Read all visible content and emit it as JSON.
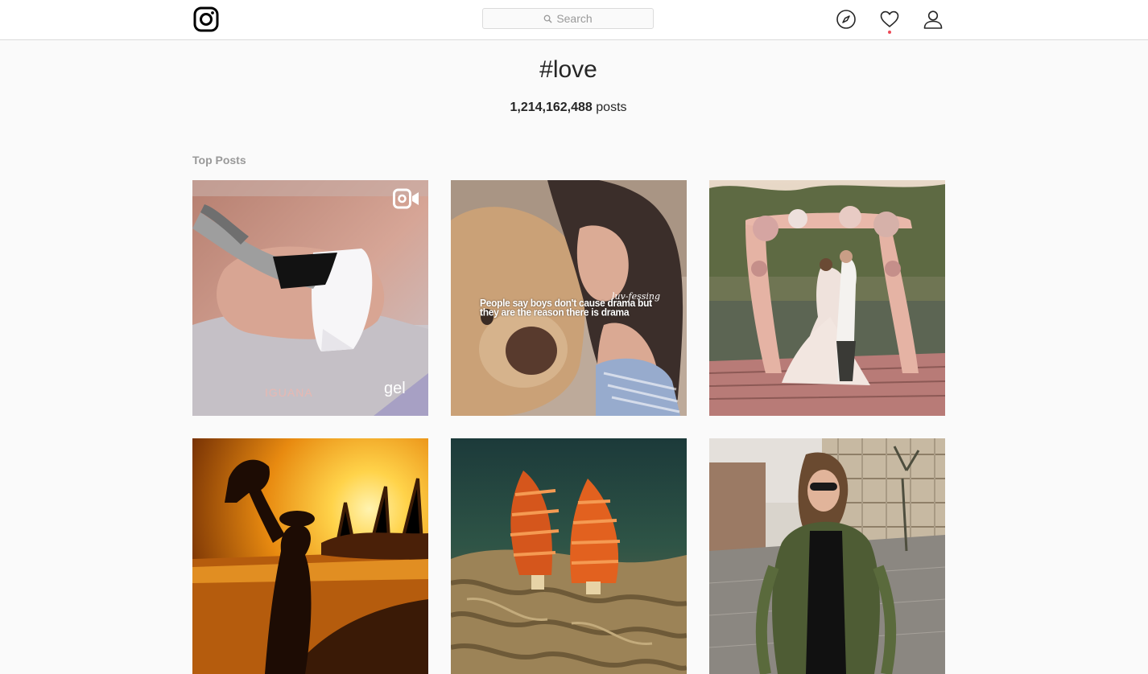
{
  "header": {
    "search_placeholder": "Search"
  },
  "hashtag": {
    "title": "#love",
    "post_count": "1,214,162,488",
    "post_count_suffix": "posts"
  },
  "section": {
    "top_posts_label": "Top Posts"
  },
  "posts": [
    {
      "subject": "nail art being painted",
      "badge": "video-icon",
      "brand": "IGUANA",
      "brand_sub": "gel"
    },
    {
      "subject": "girl hugging teddy bear",
      "overlay_text": "People say boys don't cause drama but they are the reason there is drama",
      "watermark": "luv-fessing"
    },
    {
      "subject": "wedding couple under floral arch by lake"
    },
    {
      "subject": "silhouette lifting child at sunset beach"
    },
    {
      "subject": "christmas tree worms on coral"
    },
    {
      "subject": "woman in green fur coat on city street"
    }
  ],
  "colors": {
    "background": "#fafafa",
    "border": "#dbdbdb",
    "notification": "#ed4956",
    "secondary_text": "#999999"
  }
}
